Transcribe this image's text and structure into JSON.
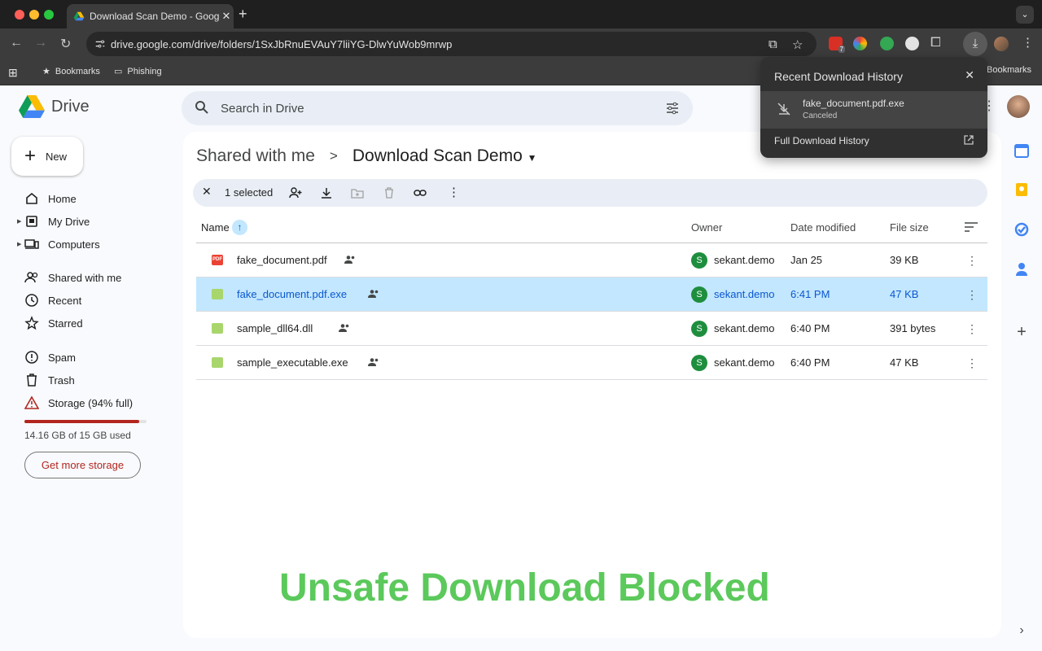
{
  "browser": {
    "tab_title": "Download Scan Demo - Google Drive",
    "url": "drive.google.com/drive/folders/1SxJbRnuEVAuY7liiYG-DlwYuWob9mrwp",
    "bookmarks": [
      "Bookmarks",
      "Phishing"
    ],
    "right_bookmarks_label": "Bookmarks",
    "extension_badge": "7"
  },
  "downloads_panel": {
    "title": "Recent Download History",
    "item_name": "fake_document.pdf.exe",
    "item_status": "Canceled",
    "full_history_label": "Full Download History"
  },
  "drive": {
    "product_name": "Drive",
    "search_placeholder": "Search in Drive",
    "new_label": "New",
    "nav": [
      {
        "label": "Home"
      },
      {
        "label": "My Drive"
      },
      {
        "label": "Computers"
      },
      {
        "label": "Shared with me"
      },
      {
        "label": "Recent"
      },
      {
        "label": "Starred"
      },
      {
        "label": "Spam"
      },
      {
        "label": "Trash"
      },
      {
        "label": "Storage (94% full)"
      }
    ],
    "storage_fraction": 0.94,
    "storage_text": "14.16 GB of 15 GB used",
    "get_more_label": "Get more storage",
    "breadcrumb": {
      "parent": "Shared with me",
      "separator": ">",
      "current": "Download Scan Demo"
    },
    "selection_text": "1 selected",
    "columns": {
      "name": "Name",
      "owner": "Owner",
      "modified": "Date modified",
      "size": "File size"
    },
    "files": [
      {
        "name": "fake_document.pdf",
        "owner": "sekant.demo",
        "avatar": "S",
        "modified": "Jan 25",
        "size": "39 KB",
        "type": "pdf",
        "type_label": "PDF",
        "selected": false
      },
      {
        "name": "fake_document.pdf.exe",
        "owner": "sekant.demo",
        "avatar": "S",
        "modified": "6:41 PM",
        "size": "47 KB",
        "type": "binary",
        "type_label": "",
        "selected": true
      },
      {
        "name": "sample_dll64.dll",
        "owner": "sekant.demo",
        "avatar": "S",
        "modified": "6:40 PM",
        "size": "391 bytes",
        "type": "binary",
        "type_label": "",
        "selected": false
      },
      {
        "name": "sample_executable.exe",
        "owner": "sekant.demo",
        "avatar": "S",
        "modified": "6:40 PM",
        "size": "47 KB",
        "type": "binary",
        "type_label": "",
        "selected": false
      }
    ]
  },
  "overlay_banner": "Unsafe Download Blocked",
  "colors": {
    "accent_blue": "#0b57d0",
    "selected_row": "#c2e7ff",
    "warning_red": "#b3261e",
    "banner_green": "#5bc95b"
  }
}
